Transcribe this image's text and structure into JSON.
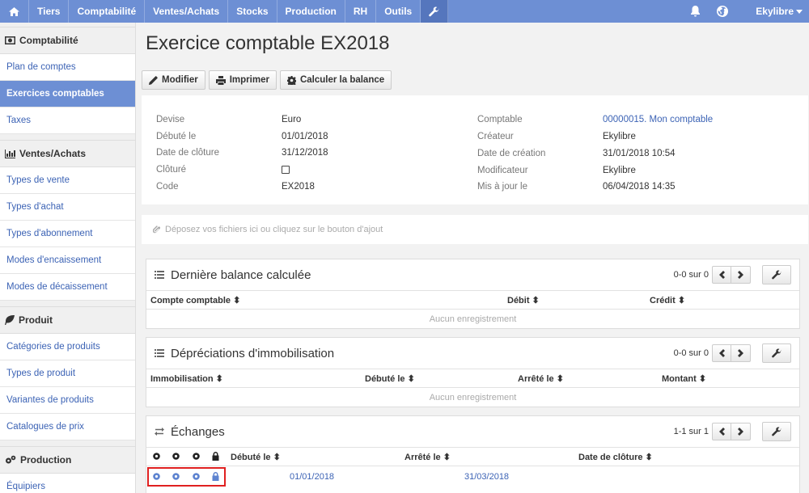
{
  "nav": {
    "items": [
      "Tiers",
      "Comptabilité",
      "Ventes/Achats",
      "Stocks",
      "Production",
      "RH",
      "Outils"
    ],
    "user": "Ekylibre"
  },
  "sidebar": {
    "groups": [
      {
        "title": "Comptabilité",
        "icon": "money-icon",
        "items": [
          "Plan de comptes",
          "Exercices comptables",
          "Taxes"
        ],
        "active": 1
      },
      {
        "title": "Ventes/Achats",
        "icon": "bar-chart-icon",
        "items": [
          "Types de vente",
          "Types d'achat",
          "Types d'abonnement",
          "Modes d'encaissement",
          "Modes de décaissement"
        ]
      },
      {
        "title": "Produit",
        "icon": "leaf-icon",
        "items": [
          "Catégories de produits",
          "Types de produit",
          "Variantes de produits",
          "Catalogues de prix"
        ]
      },
      {
        "title": "Production",
        "icon": "gears-icon",
        "items": [
          "Équipiers"
        ]
      }
    ]
  },
  "page": {
    "title": "Exercice comptable EX2018",
    "buttons": {
      "edit": "Modifier",
      "print": "Imprimer",
      "balance": "Calculer la balance"
    }
  },
  "details": {
    "left": [
      {
        "label": "Devise",
        "value": "Euro"
      },
      {
        "label": "Débuté le",
        "value": "01/01/2018"
      },
      {
        "label": "Date de clôture",
        "value": "31/12/2018"
      },
      {
        "label": "Clôturé",
        "value": ""
      },
      {
        "label": "Code",
        "value": "EX2018"
      }
    ],
    "right": [
      {
        "label": "Comptable",
        "value": "00000015. Mon comptable"
      },
      {
        "label": "Créateur",
        "value": "Ekylibre"
      },
      {
        "label": "Date de création",
        "value": "31/01/2018 10:54"
      },
      {
        "label": "Modificateur",
        "value": "Ekylibre"
      },
      {
        "label": "Mis à jour le",
        "value": "06/04/2018 14:35"
      }
    ]
  },
  "dropzone": "Déposez vos fichiers ici ou cliquez sur le bouton d'ajout",
  "panels": {
    "balance": {
      "title": "Dernière balance calculée",
      "count": "0-0 sur 0",
      "columns": [
        "Compte comptable",
        "Débit",
        "Crédit"
      ],
      "empty": "Aucun enregistrement"
    },
    "depreciation": {
      "title": "Dépréciations d'immobilisation",
      "count": "0-0 sur 0",
      "columns": [
        "Immobilisation",
        "Débuté le",
        "Arrêté le",
        "Montant"
      ],
      "empty": "Aucun enregistrement"
    },
    "exchanges": {
      "title": "Échanges",
      "count": "1-1 sur 1",
      "columns": [
        "Débuté le",
        "Arrêté le",
        "Date de clôture"
      ],
      "rows": [
        {
          "start": "01/01/2018",
          "end": "31/03/2018"
        }
      ]
    }
  },
  "colors": {
    "nav": "#6d8fd4",
    "link": "#3c63b5",
    "highlight": "#e02020"
  }
}
